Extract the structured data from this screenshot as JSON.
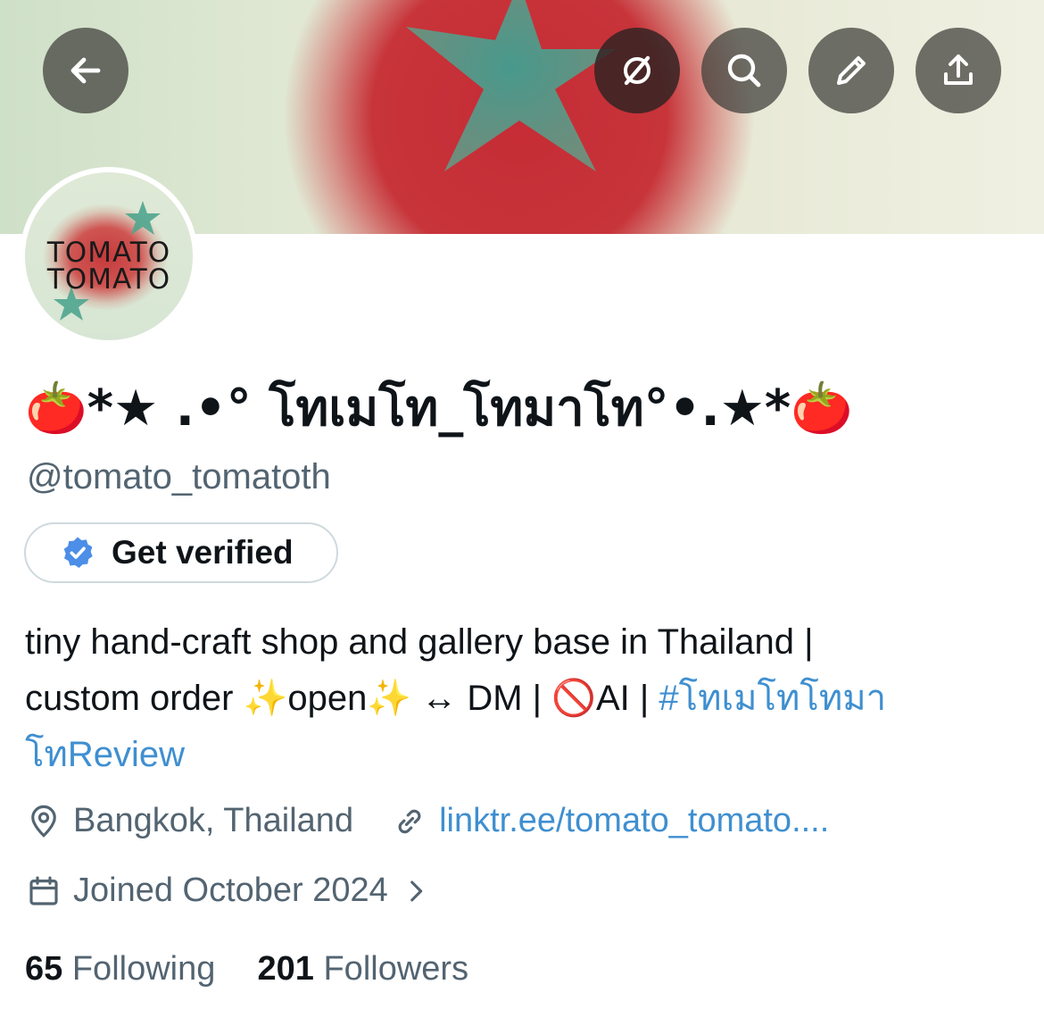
{
  "header": {
    "back_icon": "arrow-left-icon",
    "actions": [
      {
        "name": "grok-icon"
      },
      {
        "name": "search-icon"
      },
      {
        "name": "edit-pencil-icon"
      },
      {
        "name": "share-icon"
      }
    ]
  },
  "avatar": {
    "line1": "TOMATO",
    "line2": "TOMATO"
  },
  "profile": {
    "display_name": "🍅*★ .•° โทเมโท_โทมาโท°•.★*🍅",
    "handle": "@tomato_tomatoth",
    "verify_label": "Get verified",
    "bio_line1": "tiny hand-craft shop and gallery base in Thailand |",
    "bio_line2": "custom order ✨open✨ ↔ DM | 🚫AI | ",
    "bio_hashtag": "#โทเมโทโทมาโทReview",
    "location": "Bangkok, Thailand",
    "website": "linktr.ee/tomato_tomato....",
    "joined": "Joined October 2024"
  },
  "stats": {
    "following_count": "65",
    "following_label": "Following",
    "followers_count": "201",
    "followers_label": "Followers"
  },
  "colors": {
    "link": "#3f8fd0",
    "muted": "#536471",
    "verified_badge": "#4c8ee8"
  }
}
